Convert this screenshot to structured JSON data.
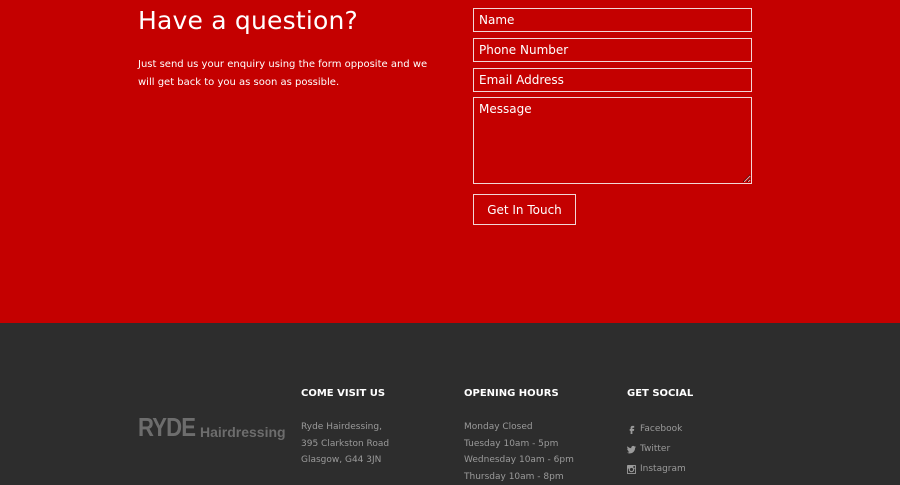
{
  "contact": {
    "heading": "Have a question?",
    "description": "Just send us your enquiry using the form opposite and we will get back to you as soon as possible.",
    "form": {
      "name_placeholder": "Name",
      "phone_placeholder": "Phone Number",
      "email_placeholder": "Email Address",
      "message_placeholder": "Message",
      "submit_label": "Get In Touch"
    },
    "bg_color": "#c40000"
  },
  "footer": {
    "logo": {
      "main": "RYDE",
      "sub": "Hairdressing"
    },
    "visit": {
      "title": "COME VISIT US",
      "lines": [
        "Ryde Hairdessing,",
        "395 Clarkston Road",
        "Glasgow, G44 3JN"
      ]
    },
    "hours": {
      "title": "OPENING HOURS",
      "lines": [
        "Monday Closed",
        "Tuesday 10am - 5pm",
        "Wednesday 10am - 6pm",
        "Thursday 10am - 8pm"
      ]
    },
    "social": {
      "title": "GET SOCIAL",
      "items": [
        {
          "label": "Facebook",
          "icon": "facebook-icon"
        },
        {
          "label": "Twitter",
          "icon": "twitter-icon"
        },
        {
          "label": "Instagram",
          "icon": "instagram-icon"
        }
      ]
    },
    "bg_color": "#2d2d2d"
  }
}
